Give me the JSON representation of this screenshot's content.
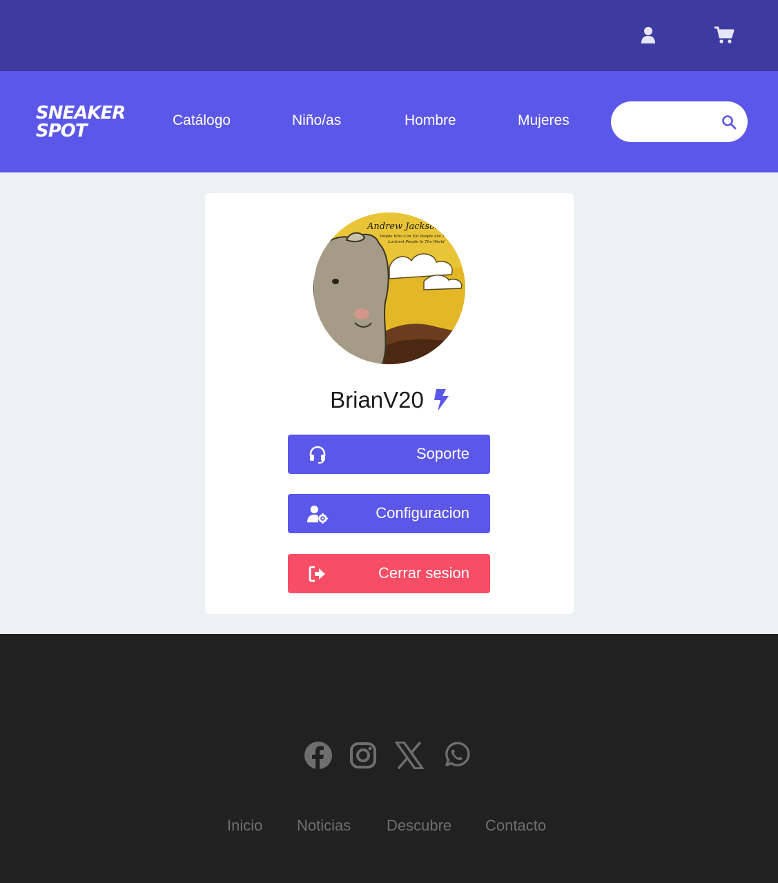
{
  "header": {
    "user_icon": "user-icon",
    "cart_icon": "cart-icon"
  },
  "nav": {
    "logo_line1": "SNEAKER",
    "logo_line2": "SPOT",
    "links": [
      "Catálogo",
      "Niño/as",
      "Hombre",
      "Mujeres"
    ],
    "search_placeholder": "",
    "search_icon": "search-icon"
  },
  "profile": {
    "avatar_text_title": "Andrew Jackson",
    "avatar_text_sub1": "People Who Can Eat People Are The",
    "avatar_text_sub2": "Luckiest People In The World",
    "username": "BrianV20",
    "badge_icon": "bolt-icon",
    "buttons": {
      "support": "Soporte",
      "config": "Configuracion",
      "logout": "Cerrar sesion"
    }
  },
  "footer": {
    "social": [
      "facebook-icon",
      "instagram-icon",
      "x-icon",
      "whatsapp-icon"
    ],
    "links": [
      "Inicio",
      "Noticias",
      "Descubre",
      "Contacto"
    ]
  },
  "colors": {
    "topbar": "#3e3ba0",
    "navbar": "#5b57e8",
    "primary_button": "#5b57e8",
    "danger_button": "#f84d66",
    "footer": "#212121",
    "page_bg": "#edf1f3"
  }
}
